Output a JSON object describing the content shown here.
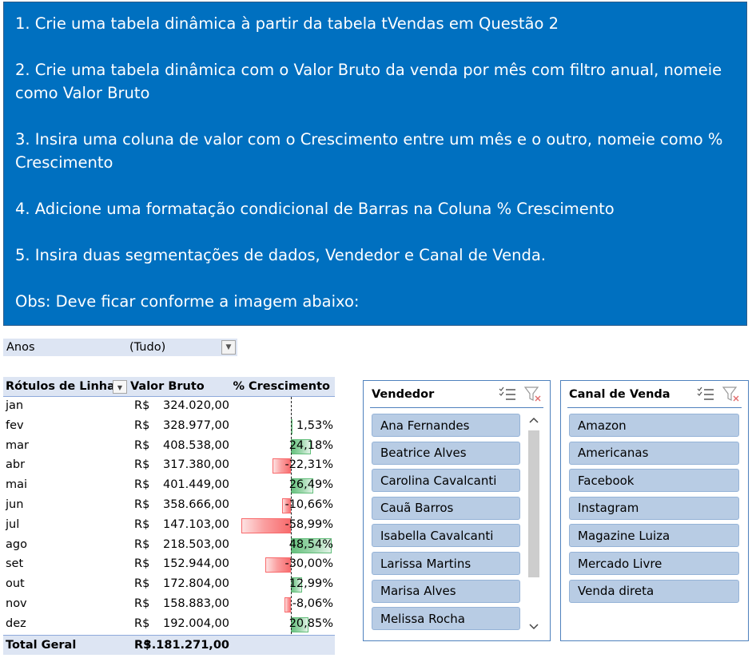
{
  "instructions": [
    "1. Crie uma tabela dinâmica à partir da tabela tVendas em Questão 2",
    "2. Crie uma tabela dinâmica com o Valor Bruto da venda por mês com filtro anual, nomeie como Valor Bruto",
    "3. Insira uma coluna de valor com o Crescimento entre um mês e o outro, nomeie como % Crescimento",
    "4. Adicione uma formatação condicional de Barras na Coluna % Crescimento",
    "5. Insira duas segmentações de dados, Vendedor e Canal de Venda.",
    "Obs: Deve ficar conforme a imagem abaixo:"
  ],
  "filter": {
    "label": "Anos",
    "value": "(Tudo)"
  },
  "pivot": {
    "headers": {
      "row_labels": "Rótulos de Linha",
      "value": "Valor Bruto",
      "growth": "% Crescimento"
    },
    "currency": "R$",
    "rows": [
      {
        "month": "jan",
        "value": "324.020,00",
        "growth": "",
        "growth_num": 0
      },
      {
        "month": "fev",
        "value": "328.977,00",
        "growth": "1,53%",
        "growth_num": 1.53
      },
      {
        "month": "mar",
        "value": "408.538,00",
        "growth": "24,18%",
        "growth_num": 24.18
      },
      {
        "month": "abr",
        "value": "317.380,00",
        "growth": "-22,31%",
        "growth_num": -22.31
      },
      {
        "month": "mai",
        "value": "401.449,00",
        "growth": "26,49%",
        "growth_num": 26.49
      },
      {
        "month": "jun",
        "value": "358.666,00",
        "growth": "-10,66%",
        "growth_num": -10.66
      },
      {
        "month": "jul",
        "value": "147.103,00",
        "growth": "-58,99%",
        "growth_num": -58.99
      },
      {
        "month": "ago",
        "value": "218.503,00",
        "growth": "48,54%",
        "growth_num": 48.54
      },
      {
        "month": "set",
        "value": "152.944,00",
        "growth": "-30,00%",
        "growth_num": -30.0
      },
      {
        "month": "out",
        "value": "172.804,00",
        "growth": "12,99%",
        "growth_num": 12.99
      },
      {
        "month": "nov",
        "value": "158.883,00",
        "growth": "-8,06%",
        "growth_num": -8.06
      },
      {
        "month": "dez",
        "value": "192.004,00",
        "growth": "20,85%",
        "growth_num": 20.85
      }
    ],
    "total": {
      "label": "Total Geral",
      "value": "3.181.271,00"
    }
  },
  "slicer_vendedor": {
    "title": "Vendedor",
    "items": [
      "Ana Fernandes",
      "Beatrice Alves",
      "Carolina Cavalcanti",
      "Cauã Barros",
      "Isabella Cavalcanti",
      "Larissa Martins",
      "Marisa Alves",
      "Melissa Rocha"
    ]
  },
  "slicer_canal": {
    "title": "Canal de Venda",
    "items": [
      "Amazon",
      "Americanas",
      "Facebook",
      "Instagram",
      "Magazine Luiza",
      "Mercado Livre",
      "Venda direta"
    ]
  },
  "colors": {
    "banner": "#0070c0",
    "slicer_item": "#b8cce4",
    "positive_bar": "#63be7b",
    "negative_bar": "#f8696b"
  }
}
